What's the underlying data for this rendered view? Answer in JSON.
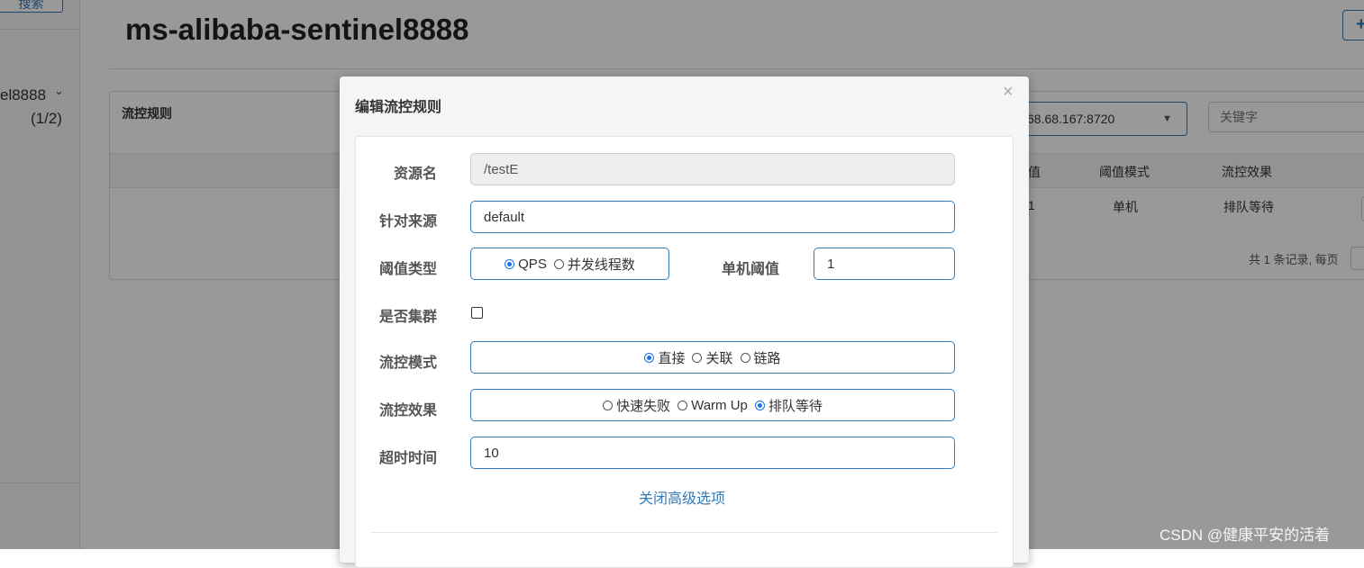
{
  "sidebar": {
    "search_label": "搜索",
    "app_name": "el8888",
    "app_count": "(1/2)"
  },
  "header": {
    "title": "ms-alibaba-sentinel8888",
    "add_label": "+"
  },
  "panel": {
    "title": "流控规则",
    "machine_select_value": "68.68.167:8720",
    "keyword_placeholder": "关键字",
    "columns": [
      "值",
      "阈值模式",
      "流控效果"
    ],
    "row": {
      "threshold": "1",
      "mode": "单机",
      "effect": "排队等待"
    },
    "pager_text": "共 1 条记录, 每页"
  },
  "modal": {
    "title": "编辑流控规则",
    "close_icon": "×",
    "resource": {
      "label": "资源名",
      "value": "/testE"
    },
    "limit_app": {
      "label": "针对来源",
      "value": "default"
    },
    "grade": {
      "label": "阈值类型",
      "options": [
        {
          "label": "QPS",
          "checked": true
        },
        {
          "label": "并发线程数",
          "checked": false
        }
      ]
    },
    "count": {
      "label": "单机阈值",
      "value": "1"
    },
    "cluster": {
      "label": "是否集群",
      "checked": false
    },
    "strategy": {
      "label": "流控模式",
      "options": [
        {
          "label": "直接",
          "checked": true
        },
        {
          "label": "关联",
          "checked": false
        },
        {
          "label": "链路",
          "checked": false
        }
      ]
    },
    "control_behavior": {
      "label": "流控效果",
      "options": [
        {
          "label": "快速失败",
          "checked": false
        },
        {
          "label": "Warm Up",
          "checked": false
        },
        {
          "label": "排队等待",
          "checked": true
        }
      ]
    },
    "timeout": {
      "label": "超时时间",
      "value": "10"
    },
    "advanced_link": "关闭高级选项"
  },
  "watermark": "CSDN @健康平安的活着",
  "colors": {
    "accent": "#337ab7",
    "radio_checked": "#1a73e8",
    "backdrop": "rgba(0,0,0,0.4)"
  }
}
